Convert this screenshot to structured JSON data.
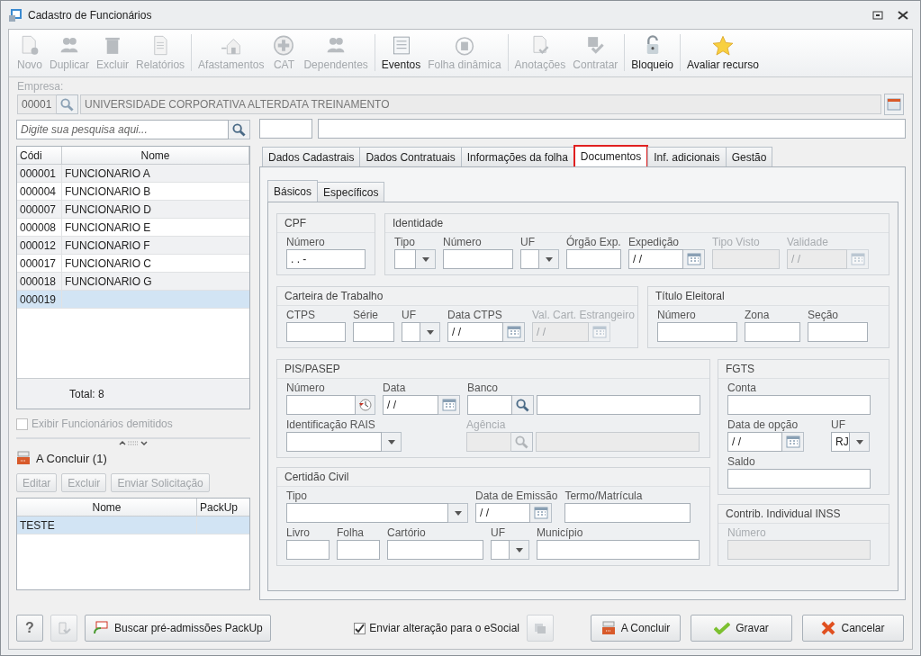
{
  "window": {
    "title": "Cadastro de Funcionários"
  },
  "toolbar": [
    [
      {
        "label": "Novo",
        "disabled": true
      },
      {
        "label": "Duplicar",
        "disabled": true
      },
      {
        "label": "Excluir",
        "disabled": true
      },
      {
        "label": "Relatórios",
        "disabled": true
      }
    ],
    [
      {
        "label": "Afastamentos",
        "disabled": true
      },
      {
        "label": "CAT",
        "disabled": true
      },
      {
        "label": "Dependentes",
        "disabled": true
      }
    ],
    [
      {
        "label": "Eventos",
        "disabled": false
      },
      {
        "label": "Folha dinâmica",
        "disabled": true
      }
    ],
    [
      {
        "label": "Anotações",
        "disabled": true
      },
      {
        "label": "Contratar",
        "disabled": true
      }
    ],
    [
      {
        "label": "Bloqueio",
        "disabled": false
      }
    ],
    [
      {
        "label": "Avaliar recurso",
        "disabled": false
      }
    ]
  ],
  "company": {
    "label": "Empresa:",
    "code": "00001",
    "name": "UNIVERSIDADE CORPORATIVA ALTERDATA TREINAMENTO"
  },
  "search": {
    "placeholder": "Digite sua pesquisa aqui..."
  },
  "employees": {
    "columns": [
      "Códi",
      "Nome"
    ],
    "rows": [
      {
        "code": "000001",
        "name": "FUNCIONARIO A",
        "selected": false
      },
      {
        "code": "000004",
        "name": "FUNCIONARIO B",
        "selected": false
      },
      {
        "code": "000007",
        "name": "FUNCIONARIO D",
        "selected": false
      },
      {
        "code": "000008",
        "name": "FUNCIONARIO E",
        "selected": false
      },
      {
        "code": "000012",
        "name": "FUNCIONARIO F",
        "selected": false
      },
      {
        "code": "000017",
        "name": "FUNCIONARIO C",
        "selected": false
      },
      {
        "code": "000018",
        "name": "FUNCIONARIO G",
        "selected": false
      },
      {
        "code": "000019",
        "selected": true
      }
    ],
    "total": "Total: 8"
  },
  "show_dismissed": {
    "label": "Exibir Funcionários demitidos",
    "checked": false,
    "disabled": true
  },
  "pending": {
    "title": "A Concluir (1)",
    "buttons": [
      {
        "label": "Editar",
        "disabled": true
      },
      {
        "label": "Excluir",
        "disabled": true
      },
      {
        "label": "Enviar Solicitação",
        "disabled": true
      }
    ],
    "columns": [
      "Nome",
      "PackUp"
    ],
    "rows": [
      {
        "name": "TESTE",
        "selected": true
      }
    ]
  },
  "tabs": [
    {
      "label": "Dados Cadastrais",
      "selected": false
    },
    {
      "label": "Dados Contratuais",
      "selected": false
    },
    {
      "label": "Informações da folha",
      "selected": false
    },
    {
      "label": "Documentos",
      "selected": true
    },
    {
      "label": "Inf. adicionais",
      "selected": false
    },
    {
      "label": "Gestão",
      "selected": false
    }
  ],
  "subtabs": [
    {
      "label": "Básicos",
      "selected": true
    },
    {
      "label": "Específicos",
      "selected": false
    }
  ],
  "groups": [
    {
      "title": "CPF",
      "fields": [
        {
          "label": "Número",
          "kind": "text",
          "value": ".  .  -",
          "disabled": false
        }
      ]
    },
    {
      "title": "Identidade",
      "fields": [
        {
          "label": "Tipo",
          "kind": "combo",
          "disabled": false
        },
        {
          "label": "Número",
          "kind": "text",
          "disabled": false
        },
        {
          "label": "UF",
          "kind": "combo",
          "disabled": false
        },
        {
          "label": "Órgão Exp.",
          "kind": "text",
          "disabled": false
        },
        {
          "label": "Expedição",
          "kind": "date",
          "value": "/ /",
          "disabled": false
        },
        {
          "label": "Tipo Visto",
          "kind": "text",
          "disabled": true
        },
        {
          "label": "Validade",
          "kind": "date",
          "value": "/ /",
          "disabled": true
        }
      ]
    },
    {
      "title": "Carteira de Trabalho",
      "fields": [
        {
          "label": "CTPS",
          "kind": "text",
          "disabled": false
        },
        {
          "label": "Série",
          "kind": "text",
          "disabled": false
        },
        {
          "label": "UF",
          "kind": "combo",
          "disabled": false
        },
        {
          "label": "Data CTPS",
          "kind": "date",
          "value": "/ /",
          "disabled": false
        },
        {
          "label": "Val. Cart. Estrangeiro",
          "kind": "date",
          "value": "/ /",
          "disabled": true
        }
      ]
    },
    {
      "title": "Título Eleitoral",
      "fields": [
        {
          "label": "Número",
          "kind": "text",
          "disabled": false
        },
        {
          "label": "Zona",
          "kind": "text",
          "disabled": false
        },
        {
          "label": "Seção",
          "kind": "text",
          "disabled": false
        }
      ]
    },
    {
      "title": "PIS/PASEP",
      "fields": [
        {
          "label": "Número",
          "kind": "history",
          "disabled": false
        },
        {
          "label": "Data",
          "kind": "date",
          "value": "/ /",
          "disabled": false
        },
        {
          "label": "Banco",
          "kind": "lookup",
          "disabled": false
        },
        {
          "label": "Identificação RAIS",
          "kind": "combo",
          "disabled": false
        },
        {
          "label": "Agência",
          "kind": "lookup",
          "disabled": true
        }
      ]
    },
    {
      "title": "Certidão Civil",
      "fields": [
        {
          "label": "Tipo",
          "kind": "combo",
          "disabled": false
        },
        {
          "label": "Data de Emissão",
          "kind": "date",
          "value": "/ /",
          "disabled": false
        },
        {
          "label": "Termo/Matrícula",
          "kind": "text",
          "disabled": false
        },
        {
          "label": "Livro",
          "kind": "text",
          "disabled": false
        },
        {
          "label": "Folha",
          "kind": "text",
          "disabled": false
        },
        {
          "label": "Cartório",
          "kind": "text",
          "disabled": false
        },
        {
          "label": "UF",
          "kind": "combo",
          "disabled": false
        },
        {
          "label": "Município",
          "kind": "text",
          "disabled": false
        }
      ]
    },
    {
      "title": "FGTS",
      "fields": [
        {
          "label": "Conta",
          "kind": "text",
          "disabled": false
        },
        {
          "label": "Data de opção",
          "kind": "date",
          "value": "/ /",
          "disabled": false
        },
        {
          "label": "UF",
          "kind": "combo",
          "value": "RJ",
          "disabled": false
        },
        {
          "label": "Saldo",
          "kind": "text",
          "disabled": false
        }
      ]
    },
    {
      "title": "Contrib. Individual INSS",
      "fields": [
        {
          "label": "Número",
          "kind": "text",
          "disabled": true
        }
      ]
    }
  ],
  "footer": {
    "help": "?",
    "packup": "Buscar pré-admissões PackUp",
    "esocial": {
      "label": "Enviar alteração para o eSocial",
      "checked": true
    },
    "buttons": [
      {
        "label": "A Concluir",
        "kind": "pending"
      },
      {
        "label": "Gravar",
        "kind": "save"
      },
      {
        "label": "Cancelar",
        "kind": "cancel"
      }
    ]
  }
}
